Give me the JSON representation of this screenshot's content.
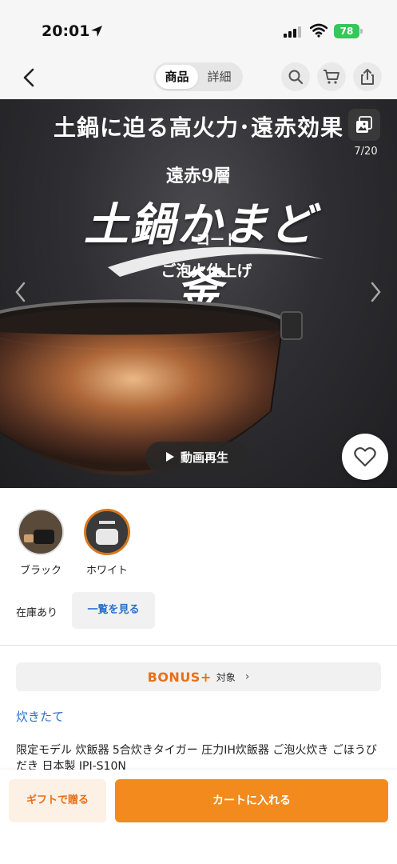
{
  "status_bar": {
    "time": "20:01",
    "battery": "78"
  },
  "nav": {
    "tabs": [
      {
        "label": "商品",
        "active": true
      },
      {
        "label": "詳細",
        "active": false
      }
    ],
    "icons": [
      "chevron-left-icon",
      "search-icon",
      "cart-icon",
      "share-icon"
    ]
  },
  "hero": {
    "headline": "土鍋に迫る高火力･遠赤効果",
    "counter": "7/20",
    "tagline": "遠赤9層",
    "brand": "土鍋かまど釜",
    "brand_sub": "コート",
    "subline": "ご泡火仕上げ",
    "video_label": "動画再生"
  },
  "variants": [
    {
      "label": "ブラック",
      "selected": false
    },
    {
      "label": "ホワイト",
      "selected": true
    }
  ],
  "stock": {
    "label": "在庫あり",
    "list_button": "一覧を見る"
  },
  "bonus": {
    "logo": "BONUS+",
    "target": "対象",
    "chevron": "›"
  },
  "shop": {
    "name": "炊きたて"
  },
  "product": {
    "title": "限定モデル 炊飯器 5合炊きタイガー 圧力IH炊飯器 ご泡火炊き ごほうびだき 日本製 JPI-S10N"
  },
  "actions": {
    "gift": "ギフトで贈る",
    "cart": "カートに入れる"
  },
  "colors": {
    "accent": "#f28a1e",
    "link": "#2a6fc9",
    "battery": "#34c759"
  }
}
